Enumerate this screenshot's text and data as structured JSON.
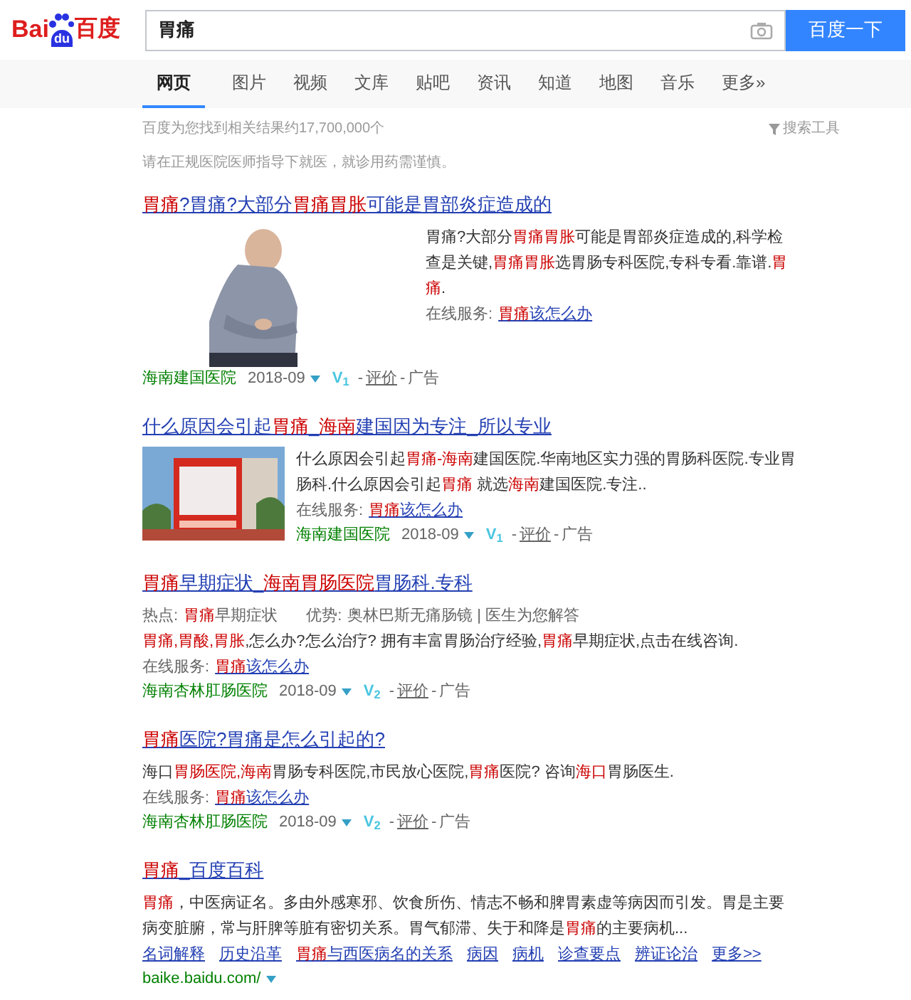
{
  "header": {
    "logo": {
      "left": "Bai",
      "paw": "du",
      "right": "百度"
    },
    "query": "胃痛",
    "button": "百度一下"
  },
  "tabs": [
    {
      "label": "网页",
      "selected": true
    },
    {
      "label": "图片",
      "selected": false
    },
    {
      "label": "视频",
      "selected": false
    },
    {
      "label": "文库",
      "selected": false
    },
    {
      "label": "贴吧",
      "selected": false
    },
    {
      "label": "资讯",
      "selected": false
    },
    {
      "label": "知道",
      "selected": false
    },
    {
      "label": "地图",
      "selected": false
    },
    {
      "label": "音乐",
      "selected": false
    },
    {
      "label": "更多»",
      "selected": false
    }
  ],
  "stats": "百度为您找到相关结果约17,700,000个",
  "tools": "搜索工具",
  "notice": "请在正规医院医师指导下就医，就诊用药需谨慎。",
  "results": [
    {
      "kind": "photo_ad",
      "title": [
        {
          "t": "胃痛",
          "hl": true
        },
        {
          "t": "?胃痛?大部分",
          "hl": false
        },
        {
          "t": "胃痛胃胀",
          "hl": true
        },
        {
          "t": "可能是胃部炎症造成的",
          "hl": false
        }
      ],
      "desc": [
        {
          "t": "胃痛?大部分",
          "hl": false
        },
        {
          "t": "胃痛胃胀",
          "hl": true
        },
        {
          "t": "可能是胃部炎症造成的,科学检查是关键,",
          "hl": false
        },
        {
          "t": "胃痛胃胀",
          "hl": true
        },
        {
          "t": "选胃肠专科医院,专科专看.靠谱.",
          "hl": false
        },
        {
          "t": "胃痛",
          "hl": true
        },
        {
          "t": ".",
          "hl": false
        }
      ],
      "service_label": "在线服务:",
      "service": [
        {
          "t": "胃痛",
          "hl": true
        },
        {
          "t": "该怎么办",
          "hl": false
        }
      ],
      "source": "海南建国医院",
      "date": "2018-09",
      "v": "V$_{1}$",
      "sep": "-",
      "review": "评价",
      "ad": "广告"
    },
    {
      "kind": "banner_ad",
      "title": [
        {
          "t": "什么原因会引起",
          "hl": false
        },
        {
          "t": "胃痛",
          "hl": true
        },
        {
          "t": "_",
          "hl": false
        },
        {
          "t": "海南",
          "hl": true
        },
        {
          "t": "建国因为专注_所以专业",
          "hl": false
        }
      ],
      "desc": [
        {
          "t": "什么原因会引起",
          "hl": false
        },
        {
          "t": "胃痛-海南",
          "hl": true
        },
        {
          "t": "建国医院.华南地区实力强的胃肠科医院.专业胃肠科.什么原因会引起",
          "hl": false
        },
        {
          "t": "胃痛",
          "hl": true
        },
        {
          "t": " 就选",
          "hl": false
        },
        {
          "t": "海南",
          "hl": true
        },
        {
          "t": "建国医院.专注..",
          "hl": false
        }
      ],
      "service_label": "在线服务:",
      "service": [
        {
          "t": "胃痛",
          "hl": true
        },
        {
          "t": "该怎么办",
          "hl": false
        }
      ],
      "source": "海南建国医院",
      "date": "2018-09",
      "v": "V$_{1}$",
      "sep": "-",
      "review": "评价",
      "ad": "广告"
    },
    {
      "kind": "text_ad",
      "title": [
        {
          "t": "胃痛",
          "hl": true
        },
        {
          "t": "早期症状_",
          "hl": false
        },
        {
          "t": "海南胃肠医院",
          "hl": true
        },
        {
          "t": "胃肠科.专科",
          "hl": false
        }
      ],
      "hot_label": "热点:",
      "hot": [
        {
          "t": "胃痛",
          "hl": true
        },
        {
          "t": "早期症状",
          "hl": false
        }
      ],
      "adv_label": "优势:",
      "adv": "奥林巴斯无痛肠镜 | 医生为您解答",
      "desc": [
        {
          "t": "胃痛,胃酸,胃胀",
          "hl": true
        },
        {
          "t": ",怎么办?怎么治疗? 拥有丰富胃肠治疗经验,",
          "hl": false
        },
        {
          "t": "胃痛",
          "hl": true
        },
        {
          "t": "早期症状,点击在线咨询.",
          "hl": false
        }
      ],
      "service_label": "在线服务:",
      "service": [
        {
          "t": "胃痛",
          "hl": true
        },
        {
          "t": "该怎么办",
          "hl": false
        }
      ],
      "source": "海南杏林肛肠医院",
      "date": "2018-09",
      "v": "V$_{2}$",
      "sep": "-",
      "review": "评价",
      "ad": "广告"
    },
    {
      "kind": "text_ad",
      "title": [
        {
          "t": "胃痛",
          "hl": true
        },
        {
          "t": "医院?胃痛是怎么引起的?",
          "hl": false
        }
      ],
      "desc": [
        {
          "t": "海口",
          "hl": false
        },
        {
          "t": "胃肠医院,海南",
          "hl": true
        },
        {
          "t": "胃肠专科医院,市民放心医院,",
          "hl": false
        },
        {
          "t": "胃痛",
          "hl": true
        },
        {
          "t": "医院? 咨询",
          "hl": false
        },
        {
          "t": "海口",
          "hl": true
        },
        {
          "t": "胃肠医生.",
          "hl": false
        }
      ],
      "service_label": "在线服务:",
      "service": [
        {
          "t": "胃痛",
          "hl": true
        },
        {
          "t": "该怎么办",
          "hl": false
        }
      ],
      "source": "海南杏林肛肠医院",
      "date": "2018-09",
      "v": "V$_{2}$",
      "sep": "-",
      "review": "评价",
      "ad": "广告"
    },
    {
      "kind": "baike",
      "title": [
        {
          "t": "胃痛",
          "hl": true
        },
        {
          "t": "_百度百科",
          "hl": false
        }
      ],
      "desc": [
        {
          "t": "胃痛",
          "hl": true
        },
        {
          "t": "，中医病证名。多由外感寒邪、饮食所伤、情志不畅和脾胃素虚等病因而引发。胃是主要病变脏腑，常与肝脾等脏有密切关系。胃气郁滞、失于和降是",
          "hl": false
        },
        {
          "t": "胃痛",
          "hl": true
        },
        {
          "t": "的主要病机...",
          "hl": false
        }
      ],
      "links": [
        [
          {
            "t": "名词解释",
            "hl": false
          }
        ],
        [
          {
            "t": "历史沿革",
            "hl": false
          }
        ],
        [
          {
            "t": "胃痛",
            "hl": true
          },
          {
            "t": "与西医病名的关系",
            "hl": false
          }
        ],
        [
          {
            "t": "病因",
            "hl": false
          }
        ],
        [
          {
            "t": "病机",
            "hl": false
          }
        ],
        [
          {
            "t": "诊查要点",
            "hl": false
          }
        ],
        [
          {
            "t": "辨证论治",
            "hl": false
          }
        ],
        [
          {
            "t": "更多>>",
            "hl": false
          }
        ]
      ],
      "url": "baike.baidu.com/"
    }
  ]
}
